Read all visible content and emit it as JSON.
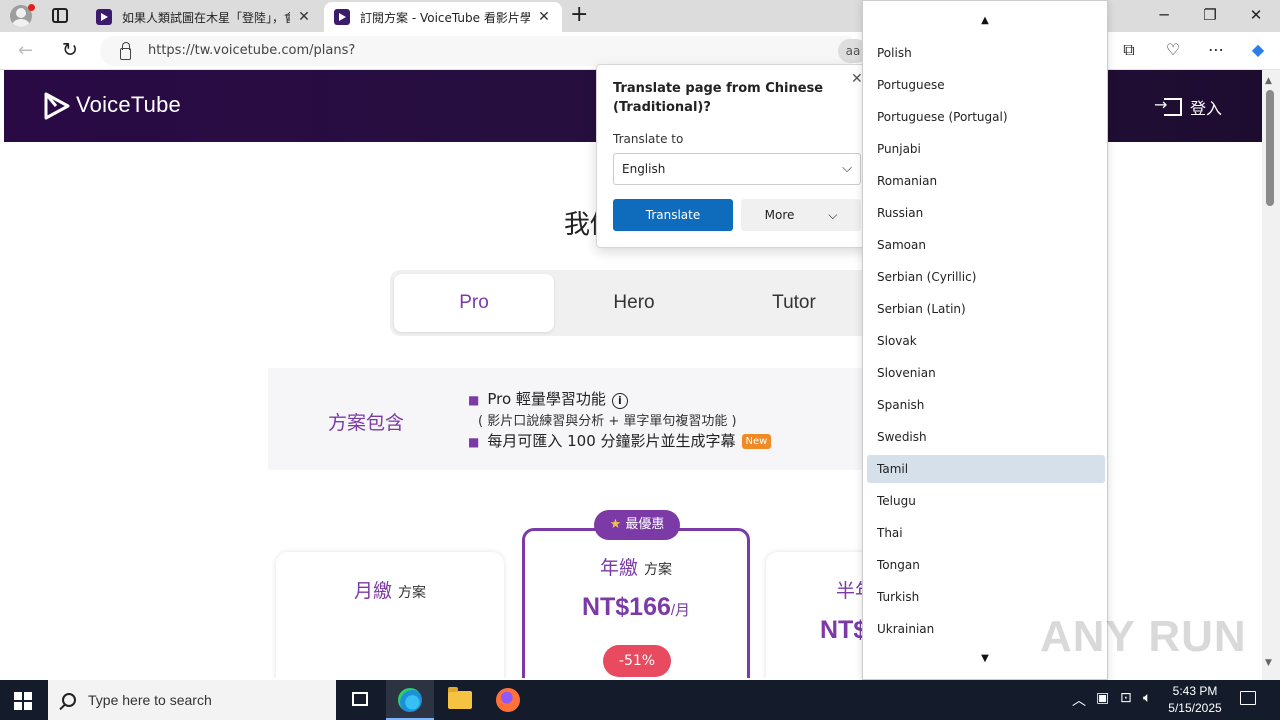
{
  "browser": {
    "tabs": [
      {
        "title": "如果人類試圖在木星「登陸」，會發",
        "active": false
      },
      {
        "title": "訂閱方案 - VoiceTube 看影片學英",
        "active": true
      }
    ],
    "url": "https://tw.voicetube.com/plans?",
    "translate_chip": "aa"
  },
  "site": {
    "logo_text": "VoiceTube",
    "login_label": "登入",
    "heading": "我們",
    "plan_tabs": [
      "Pro",
      "Hero",
      "Tutor"
    ],
    "includes": {
      "label": "方案包含",
      "feature1": "Pro 輕量學習功能",
      "feature1_sub": "( 影片口說練習與分析 + 單字單句複習功能 )",
      "feature2": "每月可匯入 100 分鐘影片並生成字幕",
      "new_badge": "New"
    },
    "cards": {
      "monthly": {
        "title": "月繳",
        "suffix": "方案"
      },
      "annual": {
        "badge": "最優惠",
        "title": "年繳",
        "suffix": "方案",
        "price": "NT$166",
        "unit": "/月",
        "discount": "-51%"
      },
      "half": {
        "title": "半年",
        "price": "NT$"
      }
    }
  },
  "translate_popup": {
    "title": "Translate page from Chinese (Traditional)?",
    "translate_to_label": "Translate to",
    "selected_language": "English",
    "translate_button": "Translate",
    "more_button": "More"
  },
  "language_list": {
    "items": [
      "Polish",
      "Portuguese",
      "Portuguese (Portugal)",
      "Punjabi",
      "Romanian",
      "Russian",
      "Samoan",
      "Serbian (Cyrillic)",
      "Serbian (Latin)",
      "Slovak",
      "Slovenian",
      "Spanish",
      "Swedish",
      "Tamil",
      "Telugu",
      "Thai",
      "Tongan",
      "Turkish",
      "Ukrainian"
    ],
    "highlighted": "Tamil"
  },
  "watermark": "ANY RUN",
  "taskbar": {
    "search_placeholder": "Type here to search",
    "time": "5:43 PM",
    "date": "5/15/2025"
  },
  "colors": {
    "brand_purple": "#7b3aa6",
    "header_bg": "#24103c",
    "translate_blue": "#0f6cbd",
    "discount_red": "#e84a5f",
    "highlight": "#d5e0ea"
  }
}
